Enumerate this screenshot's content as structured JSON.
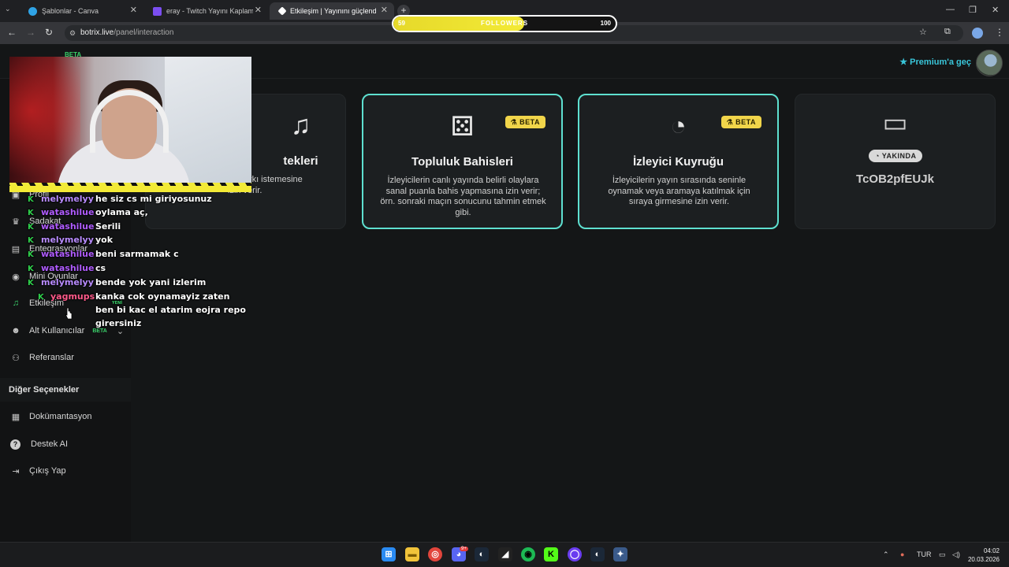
{
  "browser": {
    "tabs": [
      {
        "title": "Şablonlar - Canva",
        "close": "✕",
        "icon_color": "#2fa3e6"
      },
      {
        "title": "eray - Twitch Yayını Kaplaması",
        "close": "✕",
        "icon_color": "#7b4ef0"
      },
      {
        "title": "Etkileşim | Yayınını güçlendirme",
        "close": "✕",
        "icon_color": "#ffffff"
      }
    ],
    "new_tab": "+",
    "url_domain": "botrix.live",
    "url_path": "/panel/interaction"
  },
  "followers_goal": {
    "current": "59",
    "label": "FOLLOWERS",
    "target": "100",
    "progress": 0.59
  },
  "header": {
    "premium_label": "Premium'a geç",
    "premium_icon": "star-icon"
  },
  "sidebar": {
    "logo_badge": "BETA",
    "items": [
      {
        "label": "Profil",
        "icon": "profile-icon",
        "glyph": "▣"
      },
      {
        "label": "Sadakat",
        "icon": "trophy-icon",
        "glyph": "♛"
      },
      {
        "label": "Entegrasyonlar",
        "icon": "integrations-icon",
        "glyph": "▤"
      },
      {
        "label": "Mini Oyunlar",
        "icon": "gamepad-icon",
        "glyph": "◉"
      },
      {
        "label": "Etkileşim",
        "icon": "music-icon",
        "glyph": "♫"
      },
      {
        "label": "Alt Kullanıcılar",
        "icon": "users-icon",
        "glyph": "☻",
        "badge": "BETA",
        "chevron": "⌄"
      },
      {
        "label": "Referanslar",
        "icon": "referrals-icon",
        "glyph": "⚇"
      }
    ],
    "other_heading": "Diğer Seçenekler",
    "other_items": [
      {
        "label": "Dokümantasyon",
        "icon": "book-icon",
        "glyph": "▦"
      },
      {
        "label": "Destek AI",
        "icon": "help-icon",
        "glyph": "?"
      },
      {
        "label": "Çıkış Yap",
        "icon": "logout-icon",
        "glyph": "⇥"
      }
    ]
  },
  "cards": [
    {
      "title": "Şarkı İstekleri",
      "title_visible": "tekleri",
      "description_visible": "da şarkı istemesine\nizin verir.",
      "icon": "music-note-icon",
      "glyph": "♫"
    },
    {
      "title": "Topluluk Bahisleri",
      "description": "İzleyicilerin canlı yayında belirli olaylara sanal puanla bahis yapmasına izin verir; örn. sonraki maçın sonucunu tahmin etmek gibi.",
      "badge": "⚗ BETA",
      "icon": "dice-icon",
      "glyph": "⚄"
    },
    {
      "title": "İzleyici Kuyruğu",
      "description": "İzleyicilerin yayın sırasında seninle oynamak veya aramaya katılmak için sıraya girmesine izin verir.",
      "badge": "⚗ BETA",
      "icon": "clock-icon",
      "glyph": "◔"
    },
    {
      "soon_label": "◔ YAKINDA",
      "code": "TcOB2pfEUJk",
      "icon": "ticket-icon",
      "glyph": "▭"
    }
  ],
  "chat": [
    {
      "user": "melymelyy",
      "color": "#b98cff",
      "text": "he siz cs mi giriyosunuz"
    },
    {
      "user": "watashilue",
      "color": "#b05cff",
      "text": "oylama aç,"
    },
    {
      "user": "watashilue",
      "color": "#b05cff",
      "text": "Serili"
    },
    {
      "user": "melymelyy",
      "color": "#b98cff",
      "text": "yok"
    },
    {
      "user": "watashilue",
      "color": "#b05cff",
      "text": "beni sarmamak c"
    },
    {
      "user": "watashilue",
      "color": "#b05cff",
      "text": "cs"
    },
    {
      "user": "melymelyy",
      "color": "#b98cff",
      "text": "bende yok yani izlerim"
    },
    {
      "user": "yagmups",
      "color": "#ff5a8a",
      "text": "kanka cok oynamayiz zaten",
      "badge": "YENİ"
    },
    {
      "user": "",
      "color": "#ffffff",
      "text": "ben bi kac el atarim eojra repo"
    },
    {
      "user": "",
      "color": "#ffffff",
      "text": "girersiniz"
    }
  ],
  "chat_k": "K",
  "taskbar": {
    "apps": [
      {
        "icon": "windows-start-icon",
        "glyph": "⊞",
        "bg": "#2a8bf2"
      },
      {
        "icon": "file-explorer-icon",
        "glyph": "▬",
        "bg": "#f2c43a"
      },
      {
        "icon": "chrome-icon",
        "glyph": "◎",
        "bg": "#e2453c"
      },
      {
        "icon": "discord-icon",
        "glyph": "◕",
        "bg": "#5865f2",
        "badge": "9+"
      },
      {
        "icon": "steam-icon",
        "glyph": "◐",
        "bg": "#1b2838"
      },
      {
        "icon": "capcut-icon",
        "glyph": "◢",
        "bg": "#222222"
      },
      {
        "icon": "spotify-icon",
        "glyph": "◉",
        "bg": "#1db954"
      },
      {
        "icon": "kick-icon",
        "glyph": "K",
        "bg": "#53fc18"
      },
      {
        "icon": "obs-icon",
        "glyph": "◯",
        "bg": "#6a3df0"
      },
      {
        "icon": "steam2-icon",
        "glyph": "◐",
        "bg": "#1b2838"
      },
      {
        "icon": "settings-app-icon",
        "glyph": "✦",
        "bg": "#3a5a8a"
      }
    ],
    "language": "TUR",
    "time": "04:02",
    "date": "20.03.2026"
  }
}
